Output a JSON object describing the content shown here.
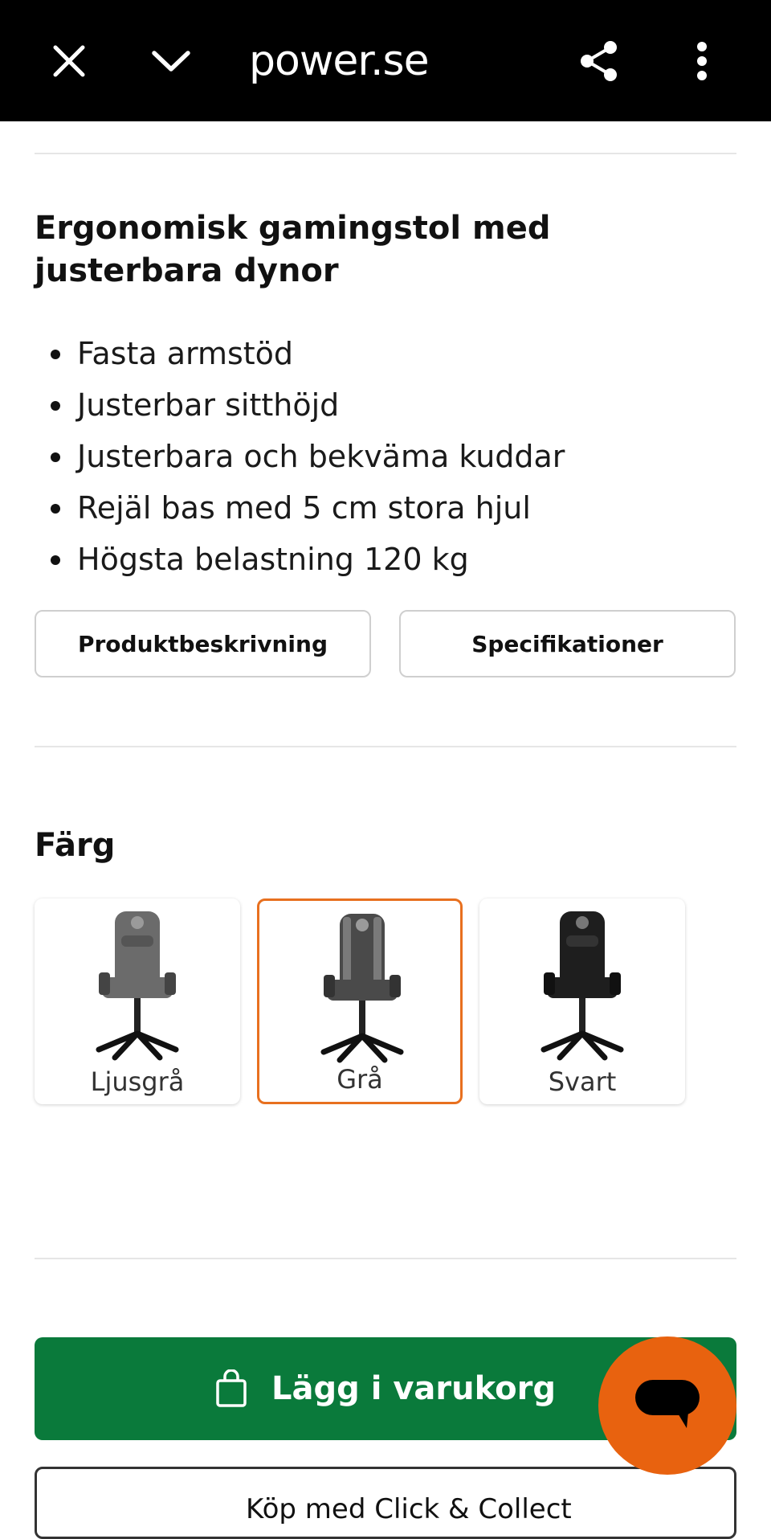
{
  "browser": {
    "url": "power.se",
    "icons": [
      "close-icon",
      "chevron-down-icon",
      "share-icon",
      "more-vertical-icon"
    ]
  },
  "product": {
    "heading": "Ergonomisk gamingstol med justerbara dynor",
    "features": [
      "Fasta armstöd",
      "Justerbar sitthöjd",
      "Justerbara och bekväma kuddar",
      "Rejäl bas med 5 cm stora hjul",
      "Högsta belastning 120 kg"
    ],
    "tabs": [
      "Produktbeskrivning",
      "Specifikationer"
    ]
  },
  "color_picker": {
    "title": "Färg",
    "selected": "Grå",
    "options": [
      {
        "label": "Ljusgrå",
        "shade": "#6b6b6b"
      },
      {
        "label": "Grå",
        "shade": "#4a4a4a"
      },
      {
        "label": "Svart",
        "shade": "#1e1e1e"
      }
    ]
  },
  "actions": {
    "add_to_cart": "Lägg i varukorg",
    "click_collect": "Köp med Click & Collect"
  },
  "colors": {
    "accent_orange": "#e8620f",
    "cart_green": "#0a7a3b"
  }
}
